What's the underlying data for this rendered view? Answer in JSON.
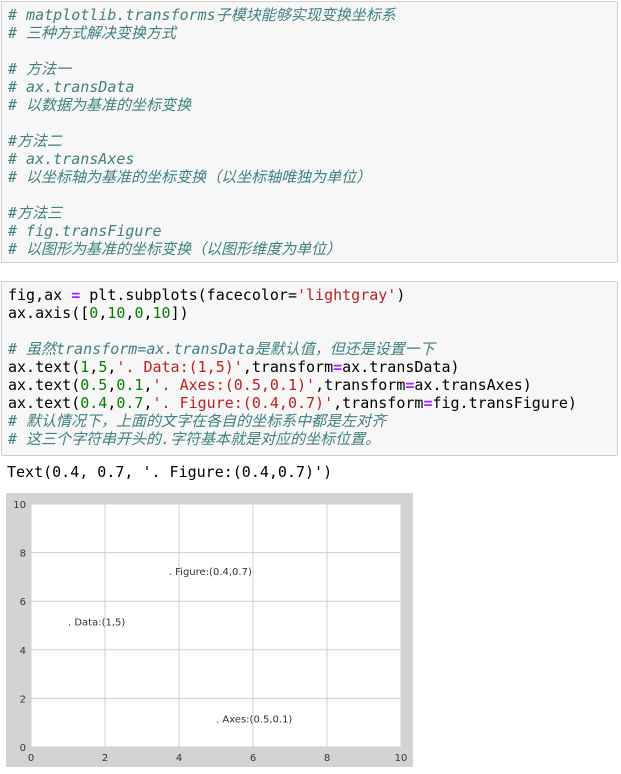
{
  "cell1": {
    "lines": [
      "# matplotlib.transforms子模块能够实现变换坐标系",
      "# 三种方式解决变换方式",
      "",
      "# 方法一",
      "# ax.transData",
      "# 以数据为基准的坐标变换",
      "",
      "#方法二",
      "# ax.transAxes",
      "# 以坐标轴为基准的坐标变换（以坐标轴唯独为单位）",
      "",
      "#方法三",
      "# fig.transFigure",
      "# 以图形为基准的坐标变换（以图形维度为单位）"
    ]
  },
  "cell2": {
    "line1": {
      "a": "fig,ax ",
      "op": "=",
      "b": " plt.subplots(facecolor=",
      "s": "'lightgray'",
      "c": ")"
    },
    "line2": {
      "a": "ax.axis([",
      "n1": "0",
      "c1": ",",
      "n2": "10",
      "c2": ",",
      "n3": "0",
      "c3": ",",
      "n4": "10",
      "e": "])"
    },
    "line3": "",
    "line4": "# 虽然transform=ax.transData是默认值，但还是设置一下",
    "line5": {
      "a": "ax.text(",
      "n1": "1",
      "c1": ",",
      "n2": "5",
      "c2": ",",
      "s": "'. Data:(1,5)'",
      "b": ",transform",
      "op": "=",
      "e": "ax.transData)"
    },
    "line6": {
      "a": "ax.text(",
      "n1": "0.5",
      "c1": ",",
      "n2": "0.1",
      "c2": ",",
      "s": "'. Axes:(0.5,0.1)'",
      "b": ",transform",
      "op": "=",
      "e": "ax.transAxes)"
    },
    "line7": {
      "a": "ax.text(",
      "n1": "0.4",
      "c1": ",",
      "n2": "0.7",
      "c2": ",",
      "s": "'. Figure:(0.4,0.7)'",
      "b": ",transform",
      "op": "=",
      "e": "fig.transFigure)"
    },
    "line8": "# 默认情况下，上面的文字在各自的坐标系中都是左对齐",
    "line9": "# 这三个字符串开头的.字符基本就是对应的坐标位置。"
  },
  "output": {
    "text": "Text(0.4, 0.7, '. Figure:(0.4,0.7)')"
  },
  "chart_data": {
    "type": "scatter",
    "xlim": [
      0,
      10
    ],
    "ylim": [
      0,
      10
    ],
    "xticks": [
      "0",
      "2",
      "4",
      "6",
      "8",
      "10"
    ],
    "yticks": [
      "0",
      "2",
      "4",
      "6",
      "8",
      "10"
    ],
    "grid": true,
    "figure_facecolor": "#d3d3d3",
    "axes_facecolor": "#ffffff",
    "annotations": [
      {
        "label": ". Data:(1,5)",
        "coords": "data",
        "x": 1,
        "y": 5
      },
      {
        "label": ". Axes:(0.5,0.1)",
        "coords": "axes",
        "x": 0.5,
        "y": 0.1
      },
      {
        "label": ". Figure:(0.4,0.7)",
        "coords": "figure",
        "x": 0.4,
        "y": 0.7
      }
    ]
  }
}
